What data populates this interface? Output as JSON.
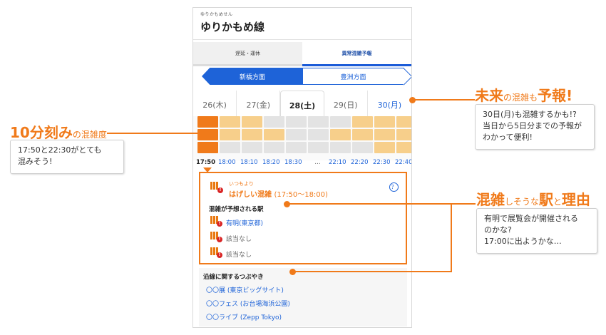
{
  "app": {
    "line_ruby": "ゆりかもめせん",
    "line_name": "ゆりかもめ線",
    "tabs": [
      "遅延・運休",
      "異常混雑予報"
    ],
    "directions": [
      "新橋方面",
      "豊洲方面"
    ],
    "days": [
      "26(木)",
      "27(金)",
      "28(土)",
      "29(日)",
      "30(月)"
    ],
    "selected_day_index": 2,
    "congestion_levels": [
      [
        2,
        1,
        1,
        0,
        0,
        0,
        0,
        1,
        1,
        1
      ],
      [
        2,
        1,
        1,
        1,
        0,
        0,
        1,
        1,
        1,
        1
      ],
      [
        2,
        0,
        0,
        0,
        0,
        0,
        0,
        0,
        1,
        1
      ]
    ],
    "times": [
      "17:50",
      "18:00",
      "18:10",
      "18:20",
      "18:30",
      "…",
      "22:10",
      "22:20",
      "22:30",
      "22:40"
    ],
    "detail": {
      "small": "いつもより",
      "main": "はげしい混雑",
      "period": "(17:50〜18:00)",
      "help_icon": "？",
      "heading": "混雑が予想される駅",
      "stations": [
        {
          "text": "有明(東京都)",
          "type": "link"
        },
        {
          "text": "該当なし",
          "type": "none"
        },
        {
          "text": "該当なし",
          "type": "none"
        }
      ]
    },
    "tweets": {
      "heading": "沿線に関するつぶやき",
      "items": [
        "〇〇展 (東京ビッグサイト)",
        "〇〇フェス (お台場海浜公園)",
        "〇〇ライブ (Zepp Tokyo)"
      ]
    }
  },
  "callouts": {
    "left": {
      "heading_big": "10分刻み",
      "heading_small": "の混雑度",
      "lines": [
        "17:50と22:30がとても",
        "混みそう!"
      ]
    },
    "top_right": {
      "h1": "未来",
      "h2": "の混雑",
      "h3": "も",
      "h4": "予報!",
      "lines": [
        "30日(月)も混雑するかも!?",
        "当日から5日分までの予報が",
        "わかって便利!"
      ]
    },
    "bottom_right": {
      "h1": "混雑",
      "h2": "しそうな",
      "h3": "駅",
      "h4": "と",
      "h5": "理由",
      "lines": [
        "有明で展覧会が開催される",
        "のかな?",
        "17:00に出ようかな…"
      ]
    }
  },
  "colors": {
    "accent": "#f07a1a",
    "light_orange": "#f7cf8b",
    "blue": "#1e63d8",
    "gray_cell": "#e3e3e3"
  }
}
